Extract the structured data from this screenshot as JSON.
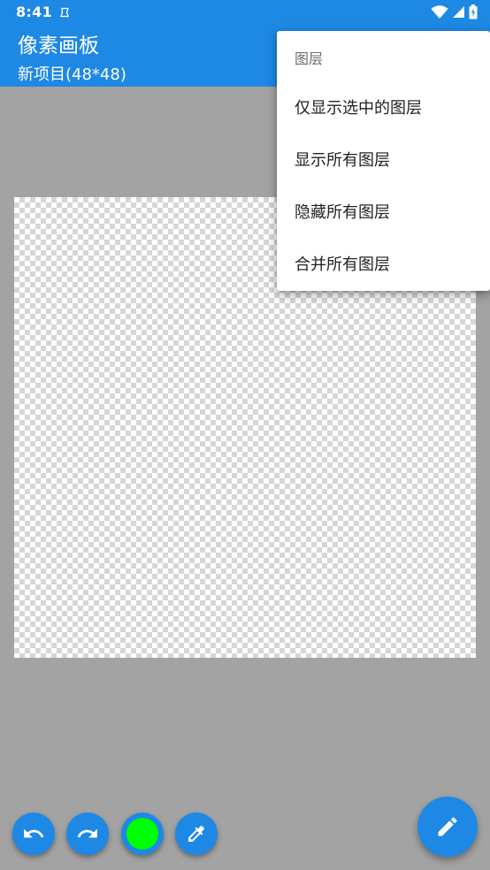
{
  "status_bar": {
    "time": "8:41",
    "icons": [
      "notification-icon",
      "wifi-icon",
      "signal-icon",
      "battery-icon"
    ]
  },
  "app_bar": {
    "title": "像素画板",
    "subtitle": "新项目(48*48)"
  },
  "layer_menu": {
    "header": "图层",
    "items": [
      {
        "label": "仅显示选中的图层"
      },
      {
        "label": "显示所有图层"
      },
      {
        "label": "隐藏所有图层"
      },
      {
        "label": "合并所有图层"
      }
    ]
  },
  "toolbar": {
    "buttons": [
      "undo-icon",
      "redo-icon",
      "color-swatch",
      "eyedropper-icon"
    ],
    "current_color": "#00ff00",
    "fab_icon": "pencil-icon"
  },
  "colors": {
    "primary": "#1e88e5",
    "background": "#a3a3a3"
  }
}
